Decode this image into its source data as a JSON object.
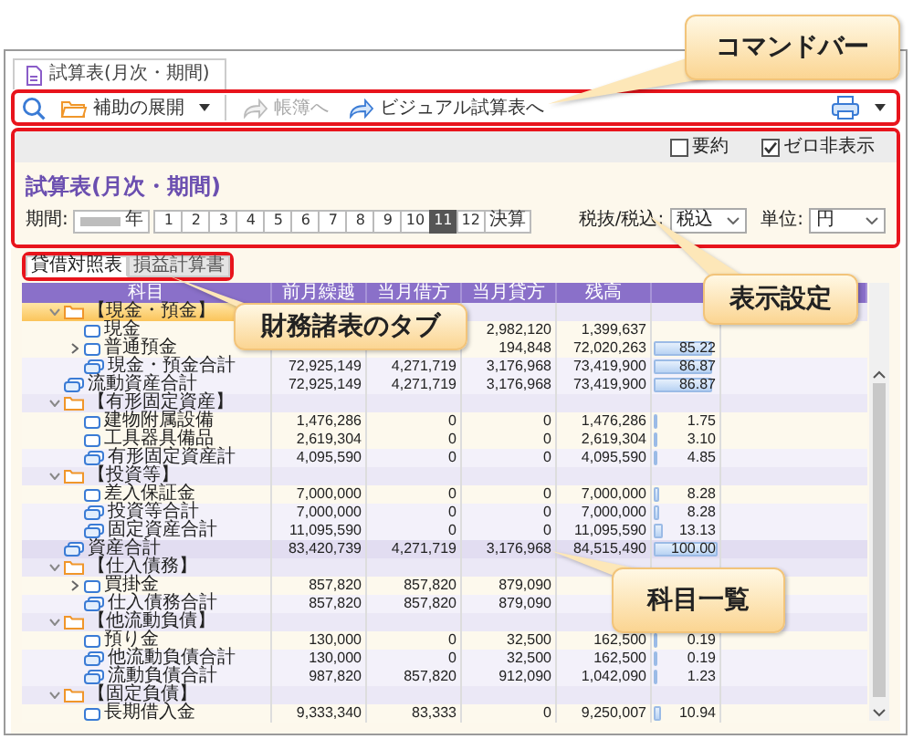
{
  "document_tab": {
    "label": "試算表(月次・期間)"
  },
  "command_bar": {
    "callout": "コマンドバー",
    "buttons": [
      {
        "kind": "menu",
        "label": "補助の展開",
        "disabled": false
      },
      {
        "kind": "link",
        "label": "帳簿へ",
        "disabled": true
      },
      {
        "kind": "link",
        "label": "ビジュアル試算表へ",
        "disabled": false
      }
    ]
  },
  "settings": {
    "callout": "表示設定",
    "options": [
      {
        "label": "要約",
        "checked": false
      },
      {
        "label": "ゼロ非表示",
        "checked": true
      }
    ],
    "title": "試算表(月次・期間)",
    "period_label": "期間:",
    "year_suffix": "年",
    "months": [
      {
        "label": "1",
        "selected": false
      },
      {
        "label": "2",
        "selected": false
      },
      {
        "label": "3",
        "selected": false
      },
      {
        "label": "4",
        "selected": false
      },
      {
        "label": "5",
        "selected": false
      },
      {
        "label": "6",
        "selected": false
      },
      {
        "label": "7",
        "selected": false
      },
      {
        "label": "8",
        "selected": false
      },
      {
        "label": "9",
        "selected": false
      },
      {
        "label": "10",
        "selected": false
      },
      {
        "label": "11",
        "selected": true
      },
      {
        "label": "12",
        "selected": false
      },
      {
        "label": "決算",
        "selected": false
      }
    ],
    "tax_label": "税抜/税込:",
    "tax_value": "税込",
    "unit_label": "単位:",
    "unit_value": "円"
  },
  "statement_tabs": {
    "callout": "財務諸表のタブ",
    "tabs": [
      {
        "label": "貸借対照表",
        "selected": true
      },
      {
        "label": "損益計算書",
        "selected": false
      }
    ]
  },
  "table": {
    "callout": "科目一覧",
    "columns": [
      "科目",
      "前月繰越",
      "当月借方",
      "当月貸方",
      "残高"
    ],
    "rows": [
      {
        "kind": "group",
        "label": "【現金・預金】",
        "expanded": true,
        "selected": true,
        "children": [
          {
            "kind": "account",
            "label": "現金",
            "selected": false,
            "cells": [
              null,
              null,
              "2,982,120",
              "1,399,637"
            ]
          },
          {
            "kind": "account",
            "label": "普通預金",
            "expanded": false,
            "selected": false,
            "cells": [
              null,
              null,
              "194,848",
              "72,020,263"
            ],
            "ratio": "85.22",
            "level": 0.8522
          },
          {
            "kind": "total",
            "label": "現金・預金合計",
            "selected": false,
            "cells": [
              "72,925,149",
              "4,271,719",
              "3,176,968",
              "73,419,900"
            ],
            "ratio": "86.87",
            "level": 0.8687
          }
        ]
      },
      {
        "kind": "total",
        "label": "流動資産合計",
        "selected": false,
        "cells": [
          "72,925,149",
          "4,271,719",
          "3,176,968",
          "73,419,900"
        ],
        "ratio": "86.87",
        "level": 0.8687
      },
      {
        "kind": "group",
        "label": "【有形固定資産】",
        "expanded": true,
        "selected": false,
        "children": [
          {
            "kind": "account",
            "label": "建物附属設備",
            "selected": false,
            "cells": [
              "1,476,286",
              "0",
              "0",
              "1,476,286"
            ],
            "ratio": "1.75",
            "level": 0.0175
          },
          {
            "kind": "account",
            "label": "工具器具備品",
            "selected": false,
            "cells": [
              "2,619,304",
              "0",
              "0",
              "2,619,304"
            ],
            "ratio": "3.10",
            "level": 0.031
          },
          {
            "kind": "total",
            "label": "有形固定資産計",
            "selected": false,
            "cells": [
              "4,095,590",
              "0",
              "0",
              "4,095,590"
            ],
            "ratio": "4.85",
            "level": 0.0485
          }
        ]
      },
      {
        "kind": "group",
        "label": "【投資等】",
        "expanded": true,
        "selected": false,
        "children": [
          {
            "kind": "account",
            "label": "差入保証金",
            "selected": false,
            "cells": [
              "7,000,000",
              "0",
              "0",
              "7,000,000"
            ],
            "ratio": "8.28",
            "level": 0.0828
          },
          {
            "kind": "total",
            "label": "投資等合計",
            "selected": false,
            "cells": [
              "7,000,000",
              "0",
              "0",
              "7,000,000"
            ],
            "ratio": "8.28",
            "level": 0.0828
          },
          {
            "kind": "total",
            "label": "固定資産合計",
            "selected": false,
            "cells": [
              "11,095,590",
              "0",
              "0",
              "11,095,590"
            ],
            "ratio": "13.13",
            "level": 0.1313
          }
        ]
      },
      {
        "kind": "grand_total",
        "label": "資産合計",
        "selected": false,
        "cells": [
          "83,420,739",
          "4,271,719",
          "3,176,968",
          "84,515,490"
        ],
        "ratio": "100.00",
        "level": 1
      },
      {
        "kind": "group",
        "label": "【仕入債務】",
        "expanded": true,
        "selected": false,
        "children": [
          {
            "kind": "account",
            "label": "買掛金",
            "expanded": false,
            "selected": false,
            "cells": [
              "857,820",
              "857,820",
              "879,090",
              null
            ]
          },
          {
            "kind": "total",
            "label": "仕入債務合計",
            "selected": false,
            "cells": [
              "857,820",
              "857,820",
              "879,090",
              null
            ]
          }
        ]
      },
      {
        "kind": "group",
        "label": "【他流動負債】",
        "expanded": true,
        "selected": false,
        "children": [
          {
            "kind": "account",
            "label": "預り金",
            "selected": false,
            "cells": [
              "130,000",
              "0",
              "32,500",
              "162,500"
            ],
            "ratio": "0.19",
            "level": 0.0019
          },
          {
            "kind": "total",
            "label": "他流動負債合計",
            "selected": false,
            "cells": [
              "130,000",
              "0",
              "32,500",
              "162,500"
            ],
            "ratio": "0.19",
            "level": 0.0019
          },
          {
            "kind": "total",
            "label": "流動負債合計",
            "selected": false,
            "cells": [
              "987,820",
              "857,820",
              "912,090",
              "1,042,090"
            ],
            "ratio": "1.23",
            "level": 0.0123
          }
        ]
      },
      {
        "kind": "group",
        "label": "【固定負債】",
        "expanded": true,
        "selected": false,
        "children": [
          {
            "kind": "account",
            "label": "長期借入金",
            "selected": false,
            "cells": [
              "9,333,340",
              "83,333",
              "0",
              "9,250,007"
            ],
            "ratio": "10.94",
            "level": 0.1094
          }
        ]
      }
    ]
  }
}
